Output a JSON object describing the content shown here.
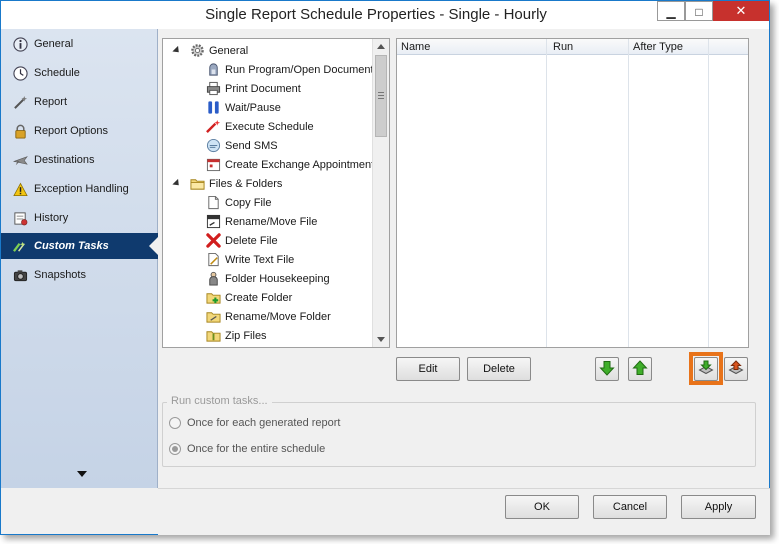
{
  "window": {
    "title": "Single Report Schedule Properties - Single - Hourly",
    "min_glyph": "▁",
    "max_glyph": "□",
    "close_glyph": "✕"
  },
  "sidebar": {
    "items": [
      {
        "label": "General",
        "icon": "info-icon"
      },
      {
        "label": "Schedule",
        "icon": "clock-icon"
      },
      {
        "label": "Report",
        "icon": "wand-icon"
      },
      {
        "label": "Report Options",
        "icon": "lock-icon"
      },
      {
        "label": "Destinations",
        "icon": "plane-icon"
      },
      {
        "label": "Exception Handling",
        "icon": "warning-icon"
      },
      {
        "label": "History",
        "icon": "history-icon"
      },
      {
        "label": "Custom Tasks",
        "icon": "custom-tasks-icon"
      },
      {
        "label": "Snapshots",
        "icon": "camera-icon"
      }
    ],
    "active_index": 7
  },
  "tree": {
    "groups": [
      {
        "label": "General",
        "icon": "gear-icon",
        "items": [
          {
            "label": "Run Program/Open Document",
            "icon": "program-icon"
          },
          {
            "label": "Print Document",
            "icon": "printer-icon"
          },
          {
            "label": "Wait/Pause",
            "icon": "pause-icon"
          },
          {
            "label": "Execute Schedule",
            "icon": "execute-icon"
          },
          {
            "label": "Send SMS",
            "icon": "sms-icon"
          },
          {
            "label": "Create Exchange Appointment",
            "icon": "appointment-icon"
          }
        ]
      },
      {
        "label": "Files & Folders",
        "icon": "folder-icon",
        "items": [
          {
            "label": "Copy File",
            "icon": "copy-file-icon"
          },
          {
            "label": "Rename/Move File",
            "icon": "rename-file-icon"
          },
          {
            "label": "Delete File",
            "icon": "delete-x-icon"
          },
          {
            "label": "Write Text File",
            "icon": "text-file-icon"
          },
          {
            "label": "Folder Housekeeping",
            "icon": "housekeeping-icon"
          },
          {
            "label": "Create Folder",
            "icon": "create-folder-icon"
          },
          {
            "label": "Rename/Move Folder",
            "icon": "rename-folder-icon"
          },
          {
            "label": "Zip Files",
            "icon": "zip-icon"
          }
        ]
      }
    ]
  },
  "tasklist": {
    "columns": [
      "Name",
      "Run",
      "After Type"
    ],
    "rows": []
  },
  "actions": {
    "edit_label": "Edit",
    "delete_label": "Delete"
  },
  "run_group": {
    "legend": "Run custom tasks...",
    "options": [
      {
        "label": "Once for each generated report",
        "checked": false
      },
      {
        "label": "Once for the entire schedule",
        "checked": true
      }
    ]
  },
  "footer": {
    "ok_label": "OK",
    "cancel_label": "Cancel",
    "apply_label": "Apply"
  },
  "colors": {
    "accent_active": "#0f3a6e",
    "highlight": "#e8731a",
    "close_red": "#c7312d"
  }
}
